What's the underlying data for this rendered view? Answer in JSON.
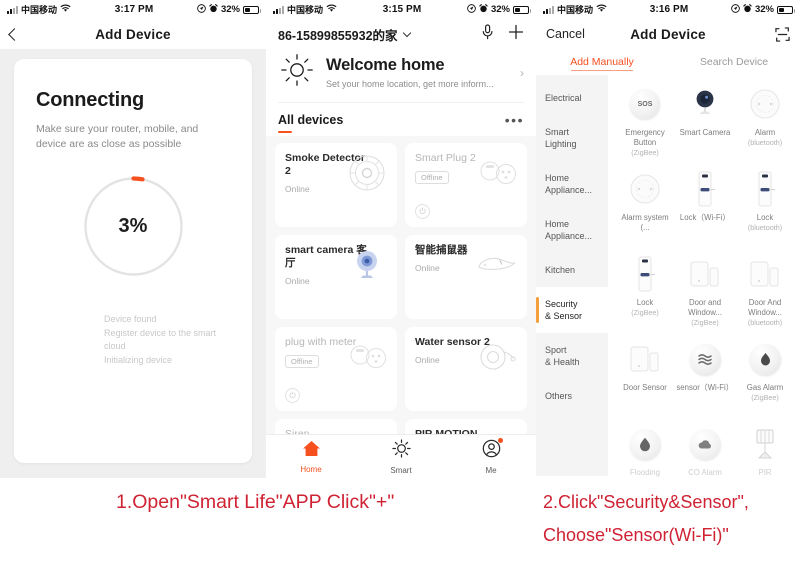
{
  "theme": {
    "accent": "#f5501e",
    "caption_color": "#cf2233",
    "panel_bg": "#efefef"
  },
  "panel1": {
    "statusbar": {
      "carrier": "中国移动",
      "time": "3:17 PM",
      "battery_pct": "32%"
    },
    "nav": {
      "back_label": "back",
      "title": "Add Device"
    },
    "card": {
      "title": "Connecting",
      "subtitle": "Make sure your router, mobile, and device are as close as possible",
      "progress_value": "3%",
      "progress_number": 3,
      "steps": [
        "Device found",
        "Register device to the smart cloud",
        "Initializing device"
      ]
    }
  },
  "panel2": {
    "statusbar": {
      "carrier": "中国移动",
      "time": "3:15 PM",
      "battery_pct": "32%"
    },
    "header": {
      "home_name": "86-15899855932的家",
      "mic_icon": "microphone-icon",
      "add_icon": "plus-icon",
      "welcome_title": "Welcome home",
      "welcome_sub": "Set your home location, get more inform...",
      "weather_icon": "sun-icon"
    },
    "tabs": {
      "all_devices": "All devices",
      "more": "•••"
    },
    "devices": [
      {
        "name": "Smoke Detector 2",
        "status": "Online",
        "offline": false,
        "icon": "smoke-detector-icon"
      },
      {
        "name": "Smart Plug 2",
        "status": "Offline",
        "offline": true,
        "icon": "smart-plug-icon"
      },
      {
        "name": "smart camera 客厅",
        "status": "Online",
        "offline": false,
        "icon": "camera-icon"
      },
      {
        "name": "智能捕鼠器",
        "status": "Online",
        "offline": false,
        "icon": "mouse-trap-icon"
      },
      {
        "name": "plug with meter",
        "status": "Offline",
        "offline": true,
        "icon": "smart-plug-icon"
      },
      {
        "name": "Water sensor 2",
        "status": "Online",
        "offline": false,
        "icon": "water-sensor-icon"
      },
      {
        "name": "Siren",
        "status": "",
        "offline": true,
        "icon": "siren-icon"
      },
      {
        "name": "PIR MOTION",
        "status": "",
        "offline": false,
        "icon": "pir-icon"
      }
    ],
    "tabbar": [
      {
        "label": "Home",
        "icon": "home-icon",
        "active": true,
        "badge": false
      },
      {
        "label": "Smart",
        "icon": "smart-sun-icon",
        "active": false,
        "badge": false
      },
      {
        "label": "Me",
        "icon": "profile-icon",
        "active": false,
        "badge": true
      }
    ]
  },
  "panel3": {
    "statusbar": {
      "carrier": "中国移动",
      "time": "3:16 PM",
      "battery_pct": "32%"
    },
    "nav": {
      "cancel": "Cancel",
      "title": "Add Device",
      "scan_icon": "scan-qr-icon"
    },
    "tabs": [
      {
        "label": "Add Manually",
        "active": true
      },
      {
        "label": "Search Device",
        "active": false
      }
    ],
    "categories": [
      {
        "label": "Electrical",
        "selected": false
      },
      {
        "label": "Smart\nLighting",
        "selected": false
      },
      {
        "label": "Home\nAppliance...",
        "selected": false
      },
      {
        "label": "Home\nAppliance...",
        "selected": false
      },
      {
        "label": "Kitchen",
        "selected": false
      },
      {
        "label": "Security\n& Sensor",
        "selected": true
      },
      {
        "label": "Sport\n& Health",
        "selected": false
      },
      {
        "label": "Others",
        "selected": false
      }
    ],
    "device_types": [
      {
        "name": "Emergency Button",
        "protocol": "(ZigBee)",
        "icon": "sos-button-icon"
      },
      {
        "name": "Smart Camera",
        "protocol": "",
        "icon": "smart-camera-icon"
      },
      {
        "name": "Alarm",
        "protocol": "(bluetooth)",
        "icon": "alarm-disc-icon"
      },
      {
        "name": "Alarm system (...",
        "protocol": "",
        "icon": "alarm-system-icon"
      },
      {
        "name": "Lock（Wi-Fi）",
        "protocol": "",
        "icon": "door-lock-icon"
      },
      {
        "name": "Lock",
        "protocol": "(bluetooth)",
        "icon": "door-lock-icon"
      },
      {
        "name": "Lock",
        "protocol": "(ZigBee)",
        "icon": "door-lock-icon"
      },
      {
        "name": "Door and Window...",
        "protocol": "(ZigBee)",
        "icon": "door-window-sensor-icon"
      },
      {
        "name": "Door And Window...",
        "protocol": "(bluetooth)",
        "icon": "door-window-sensor-icon"
      },
      {
        "name": "Door Sensor",
        "protocol": "",
        "icon": "door-sensor-icon"
      },
      {
        "name": "sensor（Wi-Fi）",
        "protocol": "",
        "icon": "wave-sensor-icon"
      },
      {
        "name": "Gas Alarm",
        "protocol": "(ZigBee)",
        "icon": "gas-alarm-icon"
      },
      {
        "name": "Flooding",
        "protocol": "",
        "icon": "water-drop-icon"
      },
      {
        "name": "CO Alarm",
        "protocol": "",
        "icon": "co-alarm-icon"
      },
      {
        "name": "PIR",
        "protocol": "",
        "icon": "pir-sensor-icon"
      }
    ]
  },
  "captions": {
    "step1": "1.Open\"Smart Life\"APP Click\"+\"",
    "step2_line1": "2.Click\"Security&Sensor\",",
    "step2_line2": "Choose\"Sensor(Wi-Fi)\""
  }
}
